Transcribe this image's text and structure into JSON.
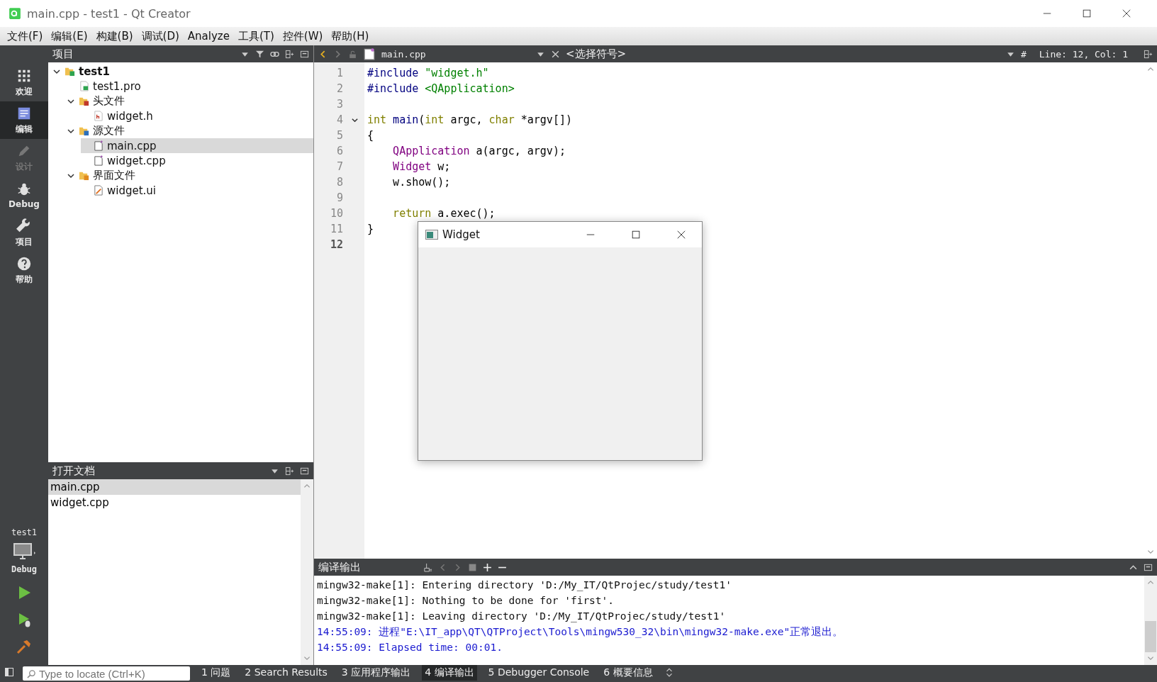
{
  "window": {
    "title": "main.cpp - test1 - Qt Creator"
  },
  "menu": [
    "文件(F)",
    "编辑(E)",
    "构建(B)",
    "调试(D)",
    "Analyze",
    "工具(T)",
    "控件(W)",
    "帮助(H)"
  ],
  "mode_bar": {
    "items": [
      {
        "label": "欢迎",
        "kind": "welcome",
        "selected": false,
        "disabled": false
      },
      {
        "label": "编辑",
        "kind": "edit",
        "selected": true,
        "disabled": false
      },
      {
        "label": "设计",
        "kind": "design",
        "selected": false,
        "disabled": true
      },
      {
        "label": "Debug",
        "kind": "debug",
        "selected": false,
        "disabled": false
      },
      {
        "label": "项目",
        "kind": "projects",
        "selected": false,
        "disabled": false
      },
      {
        "label": "帮助",
        "kind": "help",
        "selected": false,
        "disabled": false
      }
    ],
    "kit": {
      "project": "test1",
      "build": "Debug"
    }
  },
  "project_panel": {
    "title": "项目",
    "tree": [
      {
        "label": "test1",
        "kind": "project",
        "expanded": true,
        "selected": false,
        "children": [
          {
            "label": "test1.pro",
            "kind": "pro",
            "selected": false
          },
          {
            "label": "头文件",
            "kind": "headers",
            "expanded": true,
            "selected": false,
            "children": [
              {
                "label": "widget.h",
                "kind": "header",
                "selected": false
              }
            ]
          },
          {
            "label": "源文件",
            "kind": "sources",
            "expanded": true,
            "selected": false,
            "children": [
              {
                "label": "main.cpp",
                "kind": "source",
                "selected": true
              },
              {
                "label": "widget.cpp",
                "kind": "source",
                "selected": false
              }
            ]
          },
          {
            "label": "界面文件",
            "kind": "forms",
            "expanded": true,
            "selected": false,
            "children": [
              {
                "label": "widget.ui",
                "kind": "form",
                "selected": false
              }
            ]
          }
        ]
      }
    ]
  },
  "open_documents": {
    "title": "打开文档",
    "items": [
      {
        "label": "main.cpp",
        "selected": true
      },
      {
        "label": "widget.cpp",
        "selected": false
      }
    ]
  },
  "editor": {
    "file": "main.cpp",
    "symbol": "<选择符号>",
    "hash": "#",
    "position": "Line: 12, Col: 1",
    "lines": [
      {
        "number": "1",
        "current": false,
        "foldable": false,
        "tokens": [
          {
            "text": "#include",
            "kind": "preproc"
          },
          {
            "text": " \"widget.h\"",
            "kind": "string"
          }
        ]
      },
      {
        "number": "2",
        "current": false,
        "foldable": false,
        "tokens": [
          {
            "text": "#include",
            "kind": "preproc"
          },
          {
            "text": " <QApplication>",
            "kind": "string"
          }
        ]
      },
      {
        "number": "3",
        "current": false,
        "foldable": false
      },
      {
        "number": "4",
        "current": false,
        "foldable": true,
        "tokens": [
          {
            "text": "int",
            "kind": "keyword"
          },
          {
            "text": " main",
            "kind": "function"
          },
          {
            "text": "(",
            "kind": "plain"
          },
          {
            "text": "int",
            "kind": "keyword"
          },
          {
            "text": " argc, ",
            "kind": "plain"
          },
          {
            "text": "char",
            "kind": "keyword"
          },
          {
            "text": " *argv[])",
            "kind": "plain"
          }
        ]
      },
      {
        "number": "5",
        "current": false,
        "foldable": false,
        "tokens": [
          {
            "text": "{",
            "kind": "plain"
          }
        ]
      },
      {
        "number": "6",
        "current": false,
        "foldable": false,
        "tokens": [
          {
            "text": "    QApplication",
            "kind": "type"
          },
          {
            "text": " a(argc, argv);",
            "kind": "plain"
          }
        ]
      },
      {
        "number": "7",
        "current": false,
        "foldable": false,
        "tokens": [
          {
            "text": "    Widget",
            "kind": "type"
          },
          {
            "text": " w;",
            "kind": "plain"
          }
        ]
      },
      {
        "number": "8",
        "current": false,
        "foldable": false,
        "tokens": [
          {
            "text": "    w.show();",
            "kind": "plain"
          }
        ]
      },
      {
        "number": "9",
        "current": false,
        "foldable": false
      },
      {
        "number": "10",
        "current": false,
        "foldable": false,
        "tokens": [
          {
            "text": "    return",
            "kind": "keyword"
          },
          {
            "text": " a.exec();",
            "kind": "plain"
          }
        ]
      },
      {
        "number": "11",
        "current": false,
        "foldable": false,
        "tokens": [
          {
            "text": "}",
            "kind": "plain"
          }
        ]
      },
      {
        "number": "12",
        "current": true,
        "foldable": false
      }
    ]
  },
  "widget_window": {
    "title": "Widget"
  },
  "output": {
    "title": "编译输出",
    "lines": [
      {
        "text": "mingw32-make[1]: Entering directory 'D:/My_IT/QtProjec/study/test1'",
        "kind": "normal"
      },
      {
        "text": "mingw32-make[1]: Nothing to be done for 'first'.",
        "kind": "normal"
      },
      {
        "text": "mingw32-make[1]: Leaving directory 'D:/My_IT/QtProjec/study/test1'",
        "kind": "normal"
      },
      {
        "text": "14:55:09: 进程\"E:\\IT_app\\QT\\QTProject\\Tools\\mingw530_32\\bin\\mingw32-make.exe\"正常退出。",
        "kind": "info"
      },
      {
        "text": "14:55:09: Elapsed time: 00:01.",
        "kind": "info"
      }
    ]
  },
  "status_bar": {
    "locator": {
      "placeholder": "Type to locate (Ctrl+K)"
    },
    "tabs": [
      {
        "label": "1 问题",
        "selected": false
      },
      {
        "label": "2 Search Results",
        "selected": false
      },
      {
        "label": "3 应用程序输出",
        "selected": false
      },
      {
        "label": "4 编译输出",
        "selected": true
      },
      {
        "label": "5 Debugger Console",
        "selected": false
      },
      {
        "label": "6 概要信息",
        "selected": false
      }
    ]
  }
}
